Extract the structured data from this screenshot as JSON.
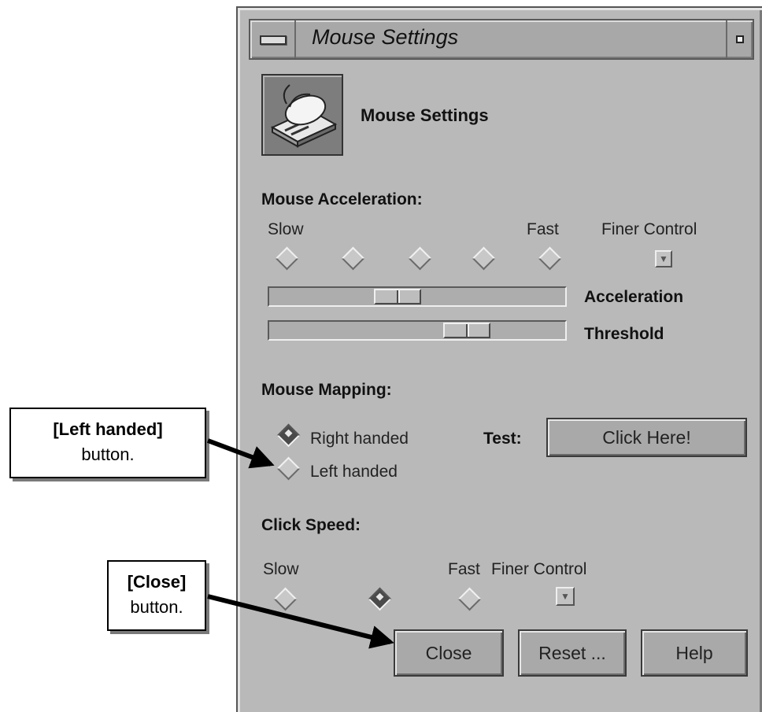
{
  "window": {
    "title": "Mouse Settings",
    "header_title": "Mouse Settings",
    "icons": {
      "app": "mouse-icon",
      "menu": "window-menu-icon",
      "maximize": "window-maximize-icon"
    }
  },
  "acceleration": {
    "heading": "Mouse Acceleration:",
    "slow_label": "Slow",
    "fast_label": "Fast",
    "finer_label": "Finer Control",
    "presets": 5,
    "acceleration_label": "Acceleration",
    "threshold_label": "Threshold",
    "acceleration_level": 0.42,
    "threshold_level": 0.7
  },
  "mapping": {
    "heading": "Mouse Mapping:",
    "right_handed_label": "Right handed",
    "left_handed_label": "Left handed",
    "selected": "right",
    "test_label": "Test:",
    "test_button_label": "Click Here!"
  },
  "click_speed": {
    "heading": "Click Speed:",
    "slow_label": "Slow",
    "fast_label": "Fast",
    "finer_label": "Finer Control",
    "selected_index": 1
  },
  "buttons": {
    "close": "Close",
    "reset": "Reset ...",
    "help": "Help"
  },
  "callouts": {
    "left_handed": {
      "title": "[Left handed]",
      "subtitle": "button."
    },
    "close": {
      "title": "[Close]",
      "subtitle": "button."
    }
  },
  "colors": {
    "window_bg": "#b9b9b9",
    "callout_border": "#000000"
  }
}
